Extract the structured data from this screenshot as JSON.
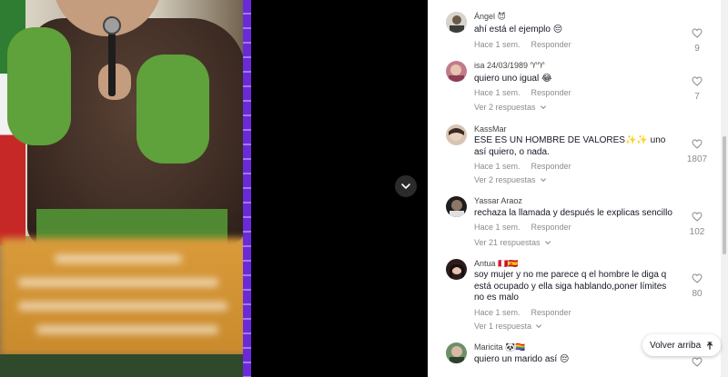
{
  "comments": [
    {
      "username": "Ángel",
      "username_emoji": "😈",
      "text": "ahí está el ejemplo 😔",
      "time": "Hace 1 sem.",
      "reply_label": "Responder",
      "likes": "9",
      "replies_label": ""
    },
    {
      "username": "isa 24/03/1989",
      "username_emoji": "♈♈",
      "text": "quiero uno igual 😂",
      "time": "Hace 1 sem.",
      "reply_label": "Responder",
      "likes": "7",
      "replies_label": "Ver 2 respuestas"
    },
    {
      "username": "KassMar",
      "username_emoji": "",
      "text": "ESE ES UN HOMBRE DE VALORES✨✨ uno así quiero, o nada.",
      "time": "Hace 1 sem.",
      "reply_label": "Responder",
      "likes": "1807",
      "replies_label": "Ver 2 respuestas"
    },
    {
      "username": "Yassar Araoz",
      "username_emoji": "",
      "text": "rechaza la llamada y después le explicas sencillo",
      "time": "Hace 1 sem.",
      "reply_label": "Responder",
      "likes": "102",
      "replies_label": "Ver 21 respuestas"
    },
    {
      "username": "Antua",
      "username_emoji": "🇵🇪🇪🇸",
      "text": "soy mujer y no me parece q el hombre le diga q está ocupado y ella siga hablando,poner límites no es malo",
      "time": "Hace 1 sem.",
      "reply_label": "Responder",
      "likes": "80",
      "replies_label": "Ver 1 respuesta"
    },
    {
      "username": "Maricita",
      "username_emoji": "🐼🏳️‍🌈",
      "text": "quiero un marido así 😔",
      "time": "",
      "reply_label": "",
      "likes": "",
      "replies_label": ""
    }
  ],
  "back_to_top_label": "Volver arriba",
  "icons": {
    "like": "heart-outline-icon",
    "expand": "chevron-down-icon",
    "scroll_down": "chevron-down-icon",
    "back_to_top": "arrow-up-icon"
  },
  "colors": {
    "text_primary": "#161823",
    "text_secondary": "#8a8b91",
    "panel_bg": "#ffffff",
    "video_bg": "#000000"
  }
}
